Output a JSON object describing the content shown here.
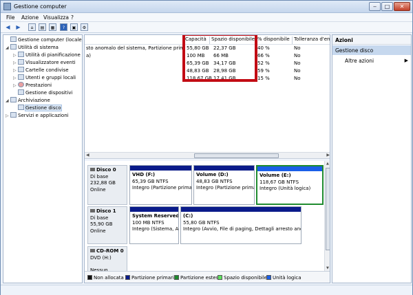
{
  "window": {
    "title": "Gestione computer"
  },
  "menu": {
    "file": "File",
    "action": "Azione",
    "view": "Visualizza",
    "help": "?"
  },
  "tree": {
    "items": [
      {
        "label": "Gestione computer (locale)",
        "level": 0,
        "twisty": ""
      },
      {
        "label": "Utilità di sistema",
        "level": 1,
        "twisty": "◢"
      },
      {
        "label": "Utilità di pianificazione",
        "level": 2,
        "twisty": "▷"
      },
      {
        "label": "Visualizzatore eventi",
        "level": 2,
        "twisty": "▷"
      },
      {
        "label": "Cartelle condivise",
        "level": 2,
        "twisty": "▷"
      },
      {
        "label": "Utenti e gruppi locali",
        "level": 2,
        "twisty": "▷"
      },
      {
        "label": "Prestazioni",
        "level": 2,
        "twisty": "▷"
      },
      {
        "label": "Gestione dispositivi",
        "level": 2,
        "twisty": ""
      },
      {
        "label": "Archiviazione",
        "level": 1,
        "twisty": "◢"
      },
      {
        "label": "Gestione disco",
        "level": 2,
        "twisty": ""
      },
      {
        "label": "Servizi e applicazioni",
        "level": 1,
        "twisty": "▷"
      }
    ]
  },
  "volumes": {
    "headers": {
      "col0": "",
      "capacity": "Capacità",
      "free": "Spazio disponibile",
      "pct": "% disponibile",
      "fault": "Tolleranza d'errori"
    },
    "rows": [
      {
        "info": "sto anomalo del sistema, Partizione primaria)",
        "capacity": "55,80 GB",
        "free": "22,37 GB",
        "pct": "40 %",
        "fault": "No"
      },
      {
        "info": "a)",
        "capacity": "100 MB",
        "free": "66 MB",
        "pct": "66 %",
        "fault": "No"
      },
      {
        "info": "",
        "capacity": "65,39 GB",
        "free": "34,17 GB",
        "pct": "52 %",
        "fault": "No"
      },
      {
        "info": "",
        "capacity": "48,83 GB",
        "free": "28,98 GB",
        "pct": "59 %",
        "fault": "No"
      },
      {
        "info": "",
        "capacity": "118,67 GB",
        "free": "17,41 GB",
        "pct": "15 %",
        "fault": "No"
      }
    ]
  },
  "disks": {
    "disk0": {
      "name": "Disco 0",
      "type": "Di base",
      "size": "232,88 GB",
      "status": "Online",
      "parts": [
        {
          "name": "VHD (F:)",
          "size": "65,39 GB NTFS",
          "state": "Integro (Partizione primari"
        },
        {
          "name": "Volume (D:)",
          "size": "48,83 GB NTFS",
          "state": "Integro (Partizione prima"
        },
        {
          "name": "Volume (E:)",
          "size": "118,67 GB NTFS",
          "state": "Integro (Unità logica)"
        }
      ]
    },
    "disk1": {
      "name": "Disco 1",
      "type": "Di base",
      "size": "55,90 GB",
      "status": "Online",
      "parts": [
        {
          "name": "System Reserved",
          "size": "100 MB NTFS",
          "state": "Integro (Sistema, Att"
        },
        {
          "name": "(C:)",
          "size": "55,80 GB NTFS",
          "state": "Integro (Avvio, File di paging, Dettagli arresto anoma"
        }
      ]
    },
    "cdrom0": {
      "name": "CD-ROM 0",
      "type": "DVD (H:)",
      "status": "Nessun suppo..."
    }
  },
  "legend": {
    "unallocated": "Non allocata",
    "primary": "Partizione primaria",
    "extended": "Partizione estesa",
    "free": "Spazio disponibile",
    "logical": "Unità logica"
  },
  "actions": {
    "header": "Azioni",
    "section": "Gestione disco",
    "more": "Altre azioni"
  },
  "colors": {
    "primary": "#0a1b8a",
    "extended": "#1f8b2e",
    "free": "#5ee05e",
    "logical": "#1a5fe8",
    "unallocated": "#111111",
    "highlight": "#c20c14"
  }
}
